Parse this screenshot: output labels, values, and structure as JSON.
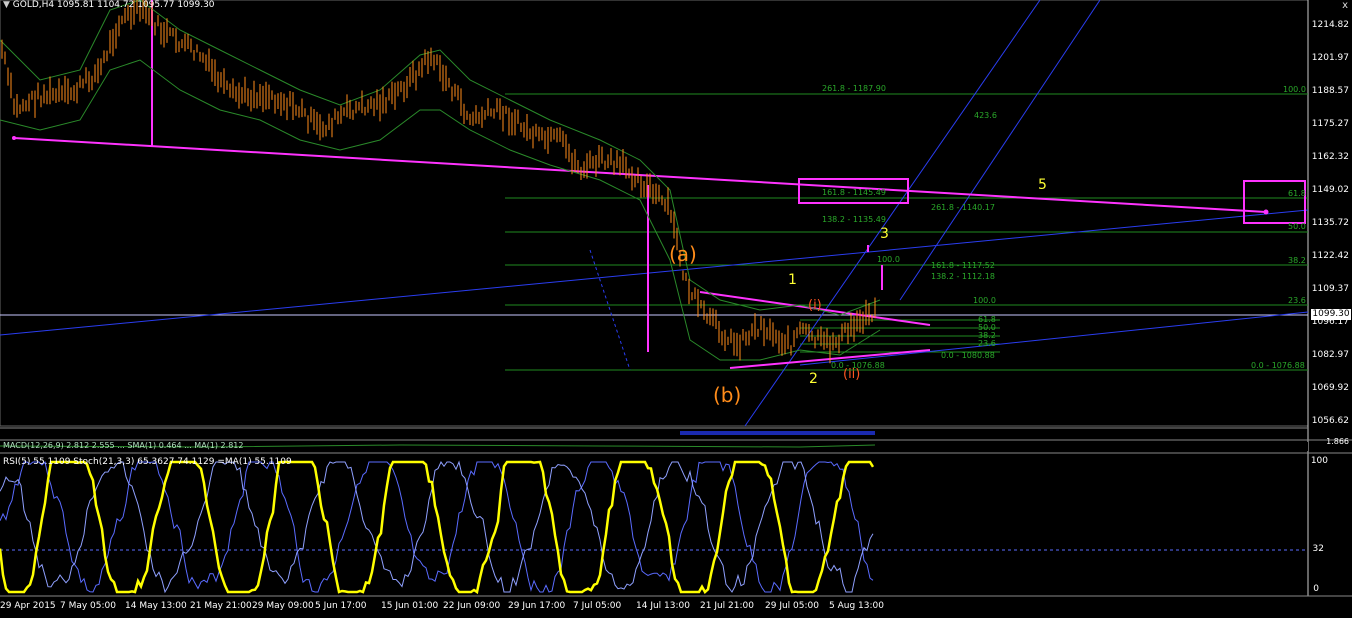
{
  "window": {
    "title": "GOLD,H4",
    "close_glyph": "x"
  },
  "ohlc": {
    "open": "1095.81",
    "high": "1104.72",
    "low": "1095.77",
    "close": "1099.30"
  },
  "price_axis": [
    "1214.82",
    "1201.97",
    "1188.57",
    "1175.27",
    "1162.32",
    "1149.02",
    "1135.72",
    "1122.42",
    "1109.37",
    "1096.17",
    "1082.97",
    "1069.92",
    "1056.62"
  ],
  "current_price": "1099.30",
  "time_axis": [
    "29 Apr 2015",
    "7 May 05:00",
    "14 May 13:00",
    "21 May 21:00",
    "29 May 09:00",
    "5 Jun 17:00",
    "15 Jun 01:00",
    "22 Jun 09:00",
    "29 Jun 17:00",
    "7 Jul 05:00",
    "14 Jul 13:00",
    "21 Jul 21:00",
    "29 Jul 05:00",
    "5 Aug 13:00"
  ],
  "macd_title": "MACD(12,26,9) 2.812 2.555 ... SMA(1) 0.464 ... MA(1) 2.812",
  "macd_axis": "1.866",
  "indicator_title": "RSI(5) 55.1109  Stoch(21,3,3) 65.3627 74.1129  =MA(1) 55.1109",
  "indicator_axis": [
    "100",
    "32",
    "0"
  ],
  "wave_labels": {
    "a": "(a)",
    "b": "(b)",
    "i": "(i)",
    "ii": "(ii)",
    "w1": "1",
    "w2": "2",
    "w3": "3",
    "w5": "5"
  },
  "fib_labels": {
    "f1": "261.8 - 1187.90",
    "f2": "100.0",
    "f3": "423.6",
    "f4": "161.8 - 1145.49",
    "f5": "261.8 - 1140.17",
    "f6": "61.8",
    "f7": "138.2 - 1135.49",
    "f8": "50.0",
    "f9": "100.0",
    "f10": "161.8 - 1117.52",
    "f11": "38.2",
    "f12": "138.2 - 1112.18",
    "f13": "100.0",
    "f14": "23.6",
    "f15": "61.8",
    "f16": "50.0",
    "f17": "38.2",
    "f18": "23.6",
    "f19": "0.0 - 1080.88",
    "f20": "0.0 - 1076.88",
    "f21": "0.0 - 1076.88"
  },
  "colors": {
    "candle": "#ff8c1a",
    "fib": "#1f8a1f",
    "trend": "#ff33ff",
    "channel": "#2a3df0",
    "rsi": "#ffff00",
    "stoch": "#5a6bff",
    "wave_yellow": "#ffff33",
    "wave_orange": "#ff8c1a"
  }
}
